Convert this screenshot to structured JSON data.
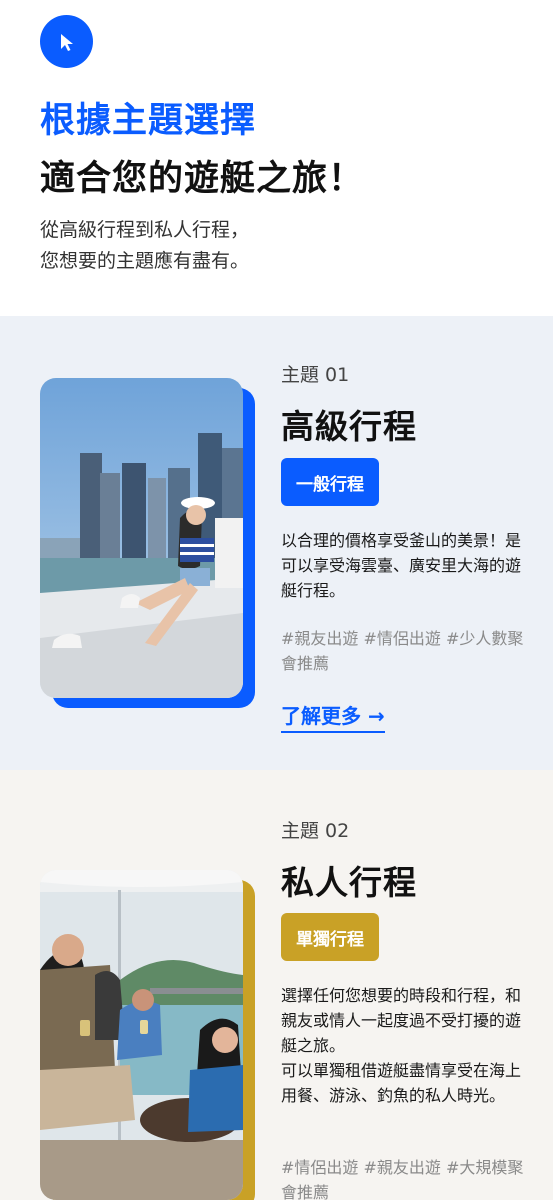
{
  "hero": {
    "title_line1": "根據主題選擇",
    "title_line2": "適合您的遊艇之旅！",
    "subtitle_line1": "從高級行程到私人行程，",
    "subtitle_line2": "您想要的主題應有盡有。",
    "icon": "cursor-arrow-icon"
  },
  "themes": [
    {
      "label": "主題 01",
      "title": "高級行程",
      "tag": "一般行程",
      "tag_color": "#0a5cff",
      "description": "以合理的價格享受釜山的美景！是可以享受海雲臺、廣安里大海的遊艇行程。",
      "hashtags": "#親友出遊 #情侶出遊 #少人數聚會推薦",
      "link": "了解更多 →"
    },
    {
      "label": "主題 02",
      "title": "私人行程",
      "tag": "單獨行程",
      "tag_color": "#c9a126",
      "description_line1": "選擇任何您想要的時段和行程，和親友或情人一起度過不受打擾的遊艇之旅。",
      "description_line2": "可以單獨租借遊艇盡情享受在海上用餐、游泳、釣魚的私人時光。",
      "hashtags": "#情侶出遊 #親友出遊 #大規模聚會推薦"
    }
  ],
  "colors": {
    "accent_blue": "#0a5cff",
    "accent_gold": "#c9a126",
    "theme1_bg": "#edf1f7",
    "theme2_bg": "#f6f4f1"
  }
}
